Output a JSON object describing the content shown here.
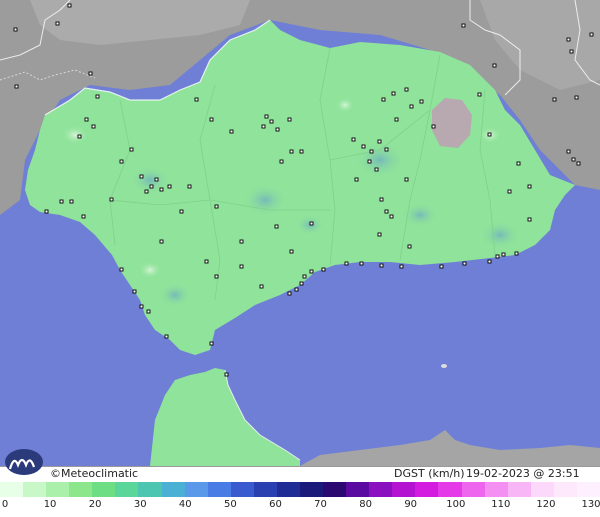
{
  "credit": "©Meteoclimatic",
  "variable_label": "DGST (km/h)",
  "timestamp": "19-02-2023 @ 23:51 UTC",
  "scale": {
    "ticks": [
      "0",
      "10",
      "20",
      "30",
      "40",
      "50",
      "60",
      "70",
      "80",
      "90",
      "100",
      "110",
      "120",
      "130"
    ],
    "colors": [
      "#e6ffe6",
      "#c8f7c8",
      "#aaf0aa",
      "#8ce68c",
      "#6ede84",
      "#5ad69a",
      "#4cc6b0",
      "#4ab0d4",
      "#5a98ea",
      "#4a7ce6",
      "#3a5ad0",
      "#2a40b0",
      "#1f2c96",
      "#1a1a7a",
      "#2a0a70",
      "#5a0aa0",
      "#8a10c0",
      "#b414d2",
      "#d41ce0",
      "#e43ae8",
      "#ee66ee",
      "#f490f2",
      "#f8b6f6",
      "#fcd8fb",
      "#fde8fc",
      "#fff0ff"
    ],
    "unit": "km/h"
  },
  "colors": {
    "sea": "#6f7fd6",
    "land_base": "#8fe39a",
    "outside": "#a8a8a8",
    "mountain": "#c0a8b0"
  }
}
